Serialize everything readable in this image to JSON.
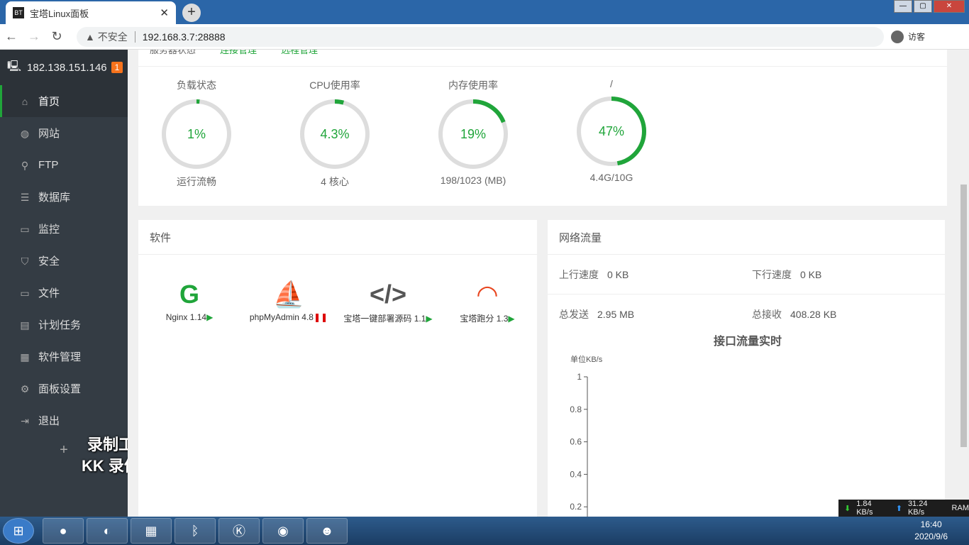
{
  "browser": {
    "tab_title": "宝塔Linux面板",
    "favicon": "BT",
    "insecure": "不安全",
    "url": "192.168.3.7:28888",
    "guest": "访客"
  },
  "sidebar": {
    "host": "182.138.151.146",
    "badge": "1",
    "items": [
      {
        "label": "首页",
        "icon": "home-icon"
      },
      {
        "label": "网站",
        "icon": "globe-icon"
      },
      {
        "label": "FTP",
        "icon": "ftp-icon"
      },
      {
        "label": "数据库",
        "icon": "database-icon"
      },
      {
        "label": "监控",
        "icon": "monitor-icon"
      },
      {
        "label": "安全",
        "icon": "shield-icon"
      },
      {
        "label": "文件",
        "icon": "folder-icon"
      },
      {
        "label": "计划任务",
        "icon": "calendar-icon"
      },
      {
        "label": "软件管理",
        "icon": "grid-icon"
      },
      {
        "label": "面板设置",
        "icon": "gear-icon"
      },
      {
        "label": "退出",
        "icon": "logout-icon"
      }
    ],
    "add": "+"
  },
  "watermark": [
    "录制工具",
    "KK 录像机"
  ],
  "status": {
    "title": "服务器状态",
    "link1": "连接管理",
    "link2": "远程管理",
    "gauges": [
      {
        "label": "负载状态",
        "value": "1%",
        "percent": 1,
        "sub": "运行流畅"
      },
      {
        "label": "CPU使用率",
        "value": "4.3%",
        "percent": 4.3,
        "sub": "4 核心"
      },
      {
        "label": "内存使用率",
        "value": "19%",
        "percent": 19,
        "sub": "198/1023 (MB)"
      },
      {
        "label": "/",
        "value": "47%",
        "percent": 47,
        "sub": "4.4G/10G"
      }
    ]
  },
  "software": {
    "title": "软件",
    "items": [
      {
        "name": "Nginx 1.14",
        "state": "▶"
      },
      {
        "name": "phpMyAdmin 4.8",
        "state": "❚❚"
      },
      {
        "name": "宝塔一键部署源码 1.1",
        "state": "▶"
      },
      {
        "name": "宝塔跑分 1.3",
        "state": "▶"
      }
    ]
  },
  "network": {
    "title": "网络流量",
    "up_label": "上行速度",
    "up": "0 KB",
    "down_label": "下行速度",
    "down": "0 KB",
    "sent_label": "总发送",
    "sent": "2.95 MB",
    "recv_label": "总接收",
    "recv": "408.28 KB"
  },
  "chart_data": {
    "type": "line",
    "title": "接口流量实时",
    "ylabel": "单位KB/s",
    "ylim": [
      0,
      1
    ],
    "yticks": [
      "1",
      "0.8",
      "0.6",
      "0.4",
      "0.2"
    ],
    "series": []
  },
  "taskbar": {
    "time": "16:40",
    "date": "2020/9/6",
    "down_speed": "1.84 KB/s",
    "up_speed": "31.24 KB/s",
    "ram": "RAM"
  },
  "colors": {
    "accent": "#20a53a",
    "sidebar": "#343c44",
    "badge": "#f7731c"
  }
}
